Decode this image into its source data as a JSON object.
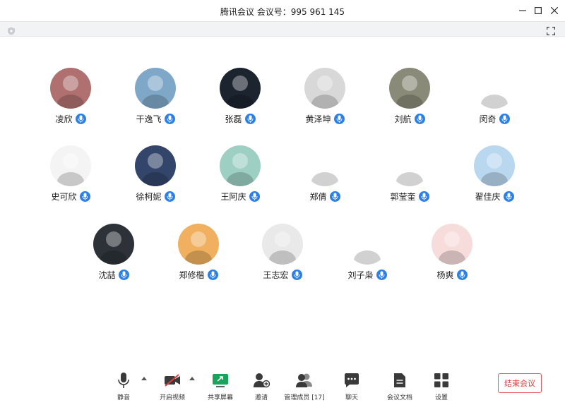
{
  "window": {
    "title": "腾讯会议 会议号：995 961 145"
  },
  "participants": [
    {
      "name": "凌欣",
      "avatar": "photo-girl-cat",
      "bg": "#b07070"
    },
    {
      "name": "干逸飞",
      "avatar": "cartoon-horse",
      "bg": "#7fa8c8"
    },
    {
      "name": "张磊",
      "avatar": "anime-dark",
      "bg": "#1c2430"
    },
    {
      "name": "黄泽坤",
      "avatar": "boy-mask",
      "bg": "#d8d8d8"
    },
    {
      "name": "刘航",
      "avatar": "street-photo",
      "bg": "#8a8a78"
    },
    {
      "name": "闵奇",
      "avatar": "fu-character",
      "bg": "#ffffff"
    },
    {
      "name": "史可欣",
      "avatar": "cartoon-girl-red",
      "bg": "#f4f4f4"
    },
    {
      "name": "徐柯妮",
      "avatar": "navy-text",
      "bg": "#34456b"
    },
    {
      "name": "王阿庆",
      "avatar": "house-illustration",
      "bg": "#9dcfc3"
    },
    {
      "name": "郑倩",
      "avatar": "cartoon-girl-mask",
      "bg": "#ffffff"
    },
    {
      "name": "郭莹奎",
      "avatar": "cartoon-red-hat",
      "bg": "#ffffff"
    },
    {
      "name": "翟佳庆",
      "avatar": "cartoon-cat-grass",
      "bg": "#b9d7ee"
    },
    {
      "name": "沈喆",
      "avatar": "cartoon-sunglasses",
      "bg": "#2d3238"
    },
    {
      "name": "郑修楷",
      "avatar": "cartoon-boy-orange",
      "bg": "#f0b060"
    },
    {
      "name": "王志宏",
      "avatar": "husky-dog",
      "bg": "#e9e9e9"
    },
    {
      "name": "刘子枭",
      "avatar": "anime-sketch",
      "bg": "#ffffff"
    },
    {
      "name": "杨爽",
      "avatar": "cartoon-duck-pink",
      "bg": "#f7dcdc"
    }
  ],
  "toolbar": {
    "mute_label": "静音",
    "video_label": "开启视频",
    "share_label": "共享屏幕",
    "invite_label": "邀请",
    "members_label": "管理成员 [17]",
    "chat_label": "聊天",
    "docs_label": "会议文档",
    "settings_label": "设置",
    "end_label": "结束会议"
  },
  "colors": {
    "accent": "#2a7fe8",
    "end": "#e23b3b",
    "share": "#1aa35a"
  }
}
